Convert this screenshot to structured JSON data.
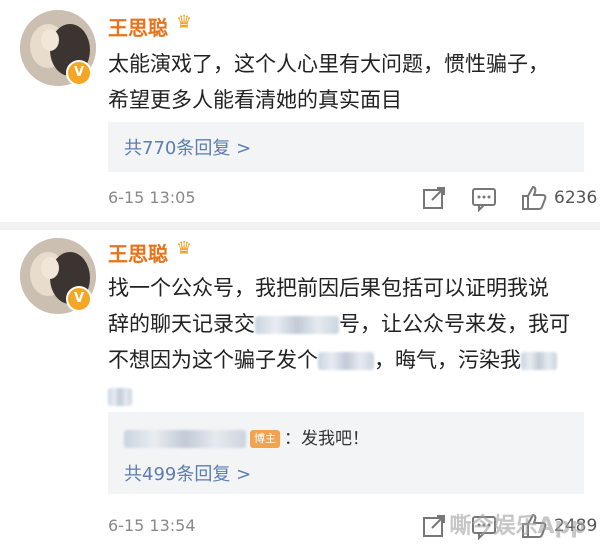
{
  "posts": [
    {
      "username": "王思聪",
      "verified_icon": "v-badge-icon",
      "crown_icon": "crown-icon",
      "content_lines": [
        "太能演戏了，这个人心里有大问题，惯性骗子，",
        "希望更多人能看清她的真实面目"
      ],
      "reply_count_label": "共770条回复 >",
      "date": "6-15 13:05",
      "likes": "6236"
    },
    {
      "username": "王思聪",
      "verified_icon": "v-badge-icon",
      "crown_icon": "crown-icon",
      "content_line1": "找一个公众号，我把前因后果包括可以证明我说",
      "content_line2a": "辞的聊天记录交",
      "content_line2b": "号，让公众号来发，我可",
      "content_line3a": "不想因为这个骗子发个",
      "content_line3b": "，晦气，污染我",
      "subreply_tag": "博主",
      "subreply_text": "：发我吧！",
      "reply_count_label": "共499条回复 >",
      "date": "6-15 13:54",
      "likes": "2489"
    }
  ],
  "watermark": "嘶今娱乐App",
  "colors": {
    "username": "#e8731a",
    "link": "#5b7db1",
    "host_tag": "#f3a34d",
    "badge": "#f5a623"
  }
}
